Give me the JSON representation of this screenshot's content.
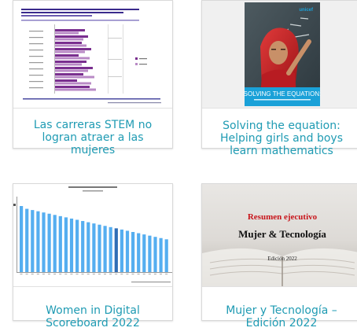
{
  "cards": [
    {
      "title": "Las carreras STEM no logran atraer a las mujeres",
      "image": "stem-careers-bar-chart-thumbnail",
      "colors": {
        "bar_dark": "#7a2f8f",
        "bar_light": "#b98ac6",
        "header": "#3a2a8c"
      }
    },
    {
      "title": "Solving the equation: Helping girls and boys learn mathematics",
      "image": "unicef-report-cover-girl-at-blackboard",
      "cover_brand": "unicef",
      "cover_title": "SOLVING THE EQUATION:",
      "colors": {
        "band": "#1aa1d8",
        "brand": "#1aa1d8"
      }
    },
    {
      "title": "Women in Digital Scoreboard 2022",
      "image": "women-in-digital-scoreboard-bar-chart-thumbnail",
      "colors": {
        "bar": "#55aef0",
        "bar_highlight": "#2f6db5"
      }
    },
    {
      "title": "Mujer y Tecnología – Edición 2022",
      "image": "mujer-tecnologia-report-cover-book",
      "cover_kicker": "Resumen ejecutivo",
      "cover_title": "Mujer & Tecnología",
      "cover_edition": "Edición 2022",
      "colors": {
        "kicker": "#c8161c",
        "title": "#111111"
      }
    }
  ],
  "accent": "#1f9bb3"
}
